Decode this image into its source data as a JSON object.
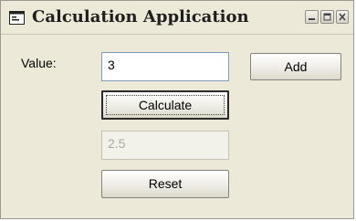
{
  "window": {
    "title": "Calculation Application",
    "icon": "application-window-icon",
    "controls": [
      "minimize-icon",
      "maximize-icon",
      "close-icon"
    ]
  },
  "form": {
    "value_label": "Value:",
    "value_input": "3",
    "add_button": "Add",
    "calculate_button": "Calculate",
    "result_value": "2.5",
    "reset_button": "Reset"
  }
}
